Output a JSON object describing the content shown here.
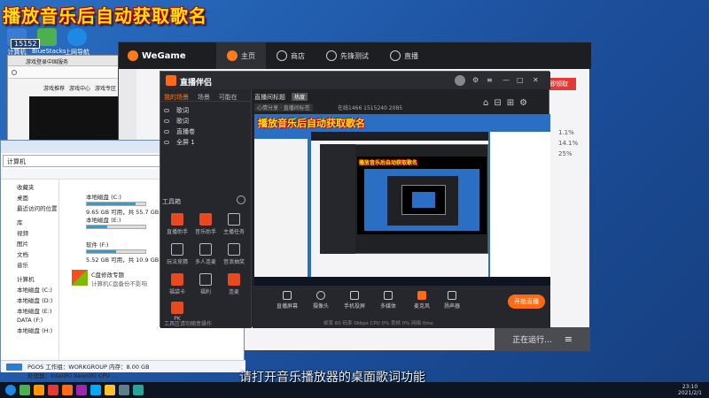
{
  "overlay": {
    "title": "播放音乐后自动获取歌名",
    "subtitle": "请打开音乐播放器的桌面歌词功能"
  },
  "desktop": {
    "icons": [
      {
        "label": "计算机",
        "color": "#3a7bd5"
      },
      {
        "label": "BlueStacks",
        "color": "#4caf50"
      },
      {
        "label": "上网导航",
        "color": "#1e88e5"
      }
    ],
    "counter": "15152"
  },
  "browser": {
    "tab": "游戏登录中国服务",
    "links": [
      "游戏推荐",
      "游戏中心",
      "游戏专区"
    ]
  },
  "wegame": {
    "logo": "WeGame",
    "tabs": [
      "主页",
      "商店",
      "先锋测试",
      "直播"
    ],
    "running_label": "正在运行...",
    "ad_label": "立即领取",
    "side_numbers": [
      "1.1%",
      "14.1%",
      "25%"
    ]
  },
  "explorer": {
    "address": "计算机",
    "sidebar": [
      "收藏夹",
      "桌面",
      "最近访问的位置",
      "库",
      "视频",
      "图片",
      "文档",
      "音乐",
      "计算机",
      "本地磁盘 (C:)",
      "本地磁盘 (D:)",
      "本地磁盘 (E:)",
      "DATA (F:)",
      "本地磁盘 (H:)"
    ],
    "drives": [
      {
        "name": "本地磁盘 (C:)",
        "info": "9.65 GB 可用，共 55.7 GB",
        "fill": 0.83
      },
      {
        "name": "本地磁盘 (E:)",
        "info": "",
        "fill": 0.35
      },
      {
        "name": "软件 (F:)",
        "info": "5.52 GB 可用，共 10.9 GB",
        "fill": 0.5
      }
    ],
    "os_label": "C盘修改专题",
    "os_sub": "计算机C盘备份不影响",
    "status": "PGOS  工作组：WORKGROUP    内存：8.00 GB",
    "status2": "处理器：Intel(R) Xeon(R) CPU ..."
  },
  "live": {
    "logo": "直播伴侣",
    "left_tabs": [
      "我的场景",
      "场景",
      "可能在"
    ],
    "scenes": [
      "歌词",
      "歌词",
      "直播卷",
      "全屏 1"
    ],
    "tools_label": "工具箱",
    "tools": [
      "直播助手",
      "音乐助手",
      "主播任务",
      "玩法竞猜",
      "多人连麦",
      "音浪抽奖",
      "福袋卡",
      "福利",
      "连麦",
      "PK"
    ],
    "footer_note": "工具区请勿随意操作",
    "room_title": "直播间标题",
    "room_badge": "热度",
    "room_stats": "在线1466  1515240  2085",
    "room_tag": "心情分享 · 直播间标签",
    "bottom_buttons": [
      "直播屏幕",
      "摄像头",
      "手机投屏",
      "多媒体",
      "麦克风",
      "扬声器"
    ],
    "start_label": "开始直播",
    "stats_line": "帧率 60  码率 0kbps  CPU 0%  丢帧 0%  网络 0ms"
  },
  "taskbar": {
    "time": "23:10",
    "date": "2021/2/1"
  }
}
